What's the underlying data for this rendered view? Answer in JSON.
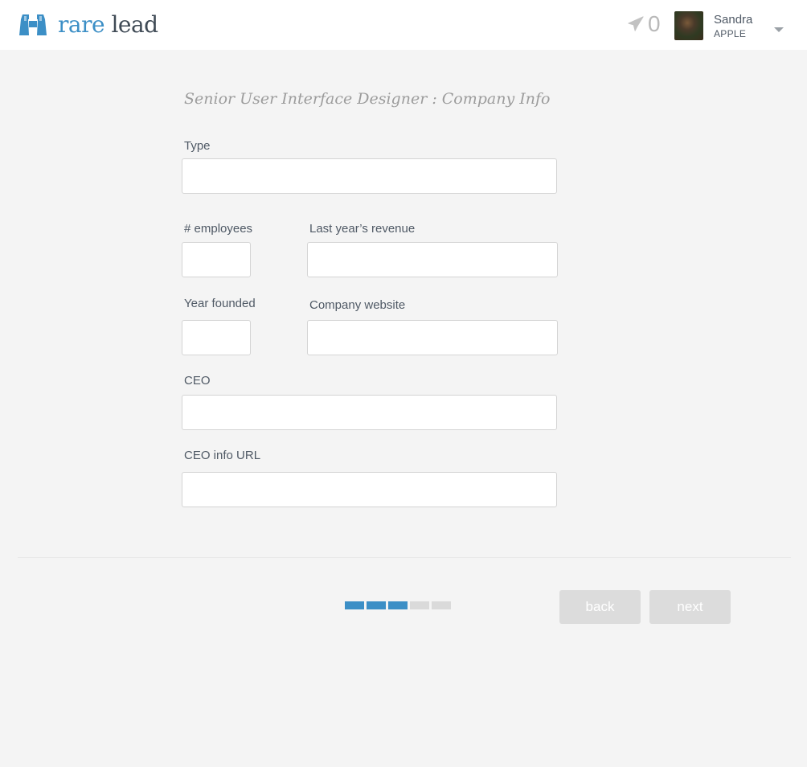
{
  "header": {
    "logo_rare": "rare",
    "logo_lead": "lead",
    "logo_icon": "binoculars-icon",
    "notifications_icon": "paper-plane-icon",
    "notifications_count": "0",
    "user_name": "Sandra",
    "user_company": "APPLE"
  },
  "page_title": "Senior User Interface Designer : Company Info",
  "form": {
    "type_label": "Type",
    "type_value": "",
    "employees_label": "# employees",
    "employees_value": "",
    "revenue_label": "Last year’s revenue",
    "revenue_value": "",
    "founded_label": "Year founded",
    "founded_value": "",
    "website_label": "Company website",
    "website_value": "",
    "ceo_label": "CEO",
    "ceo_value": "",
    "ceo_url_label": "CEO info URL",
    "ceo_url_value": ""
  },
  "progress": {
    "completed_steps": 3,
    "total_steps": 5
  },
  "buttons": {
    "back_label": "back",
    "next_label": "next"
  },
  "colors": {
    "accent": "#3c8fc6",
    "progress_inactive": "#dadada",
    "button_bg": "#dcdcdc",
    "background": "#f4f4f4"
  }
}
